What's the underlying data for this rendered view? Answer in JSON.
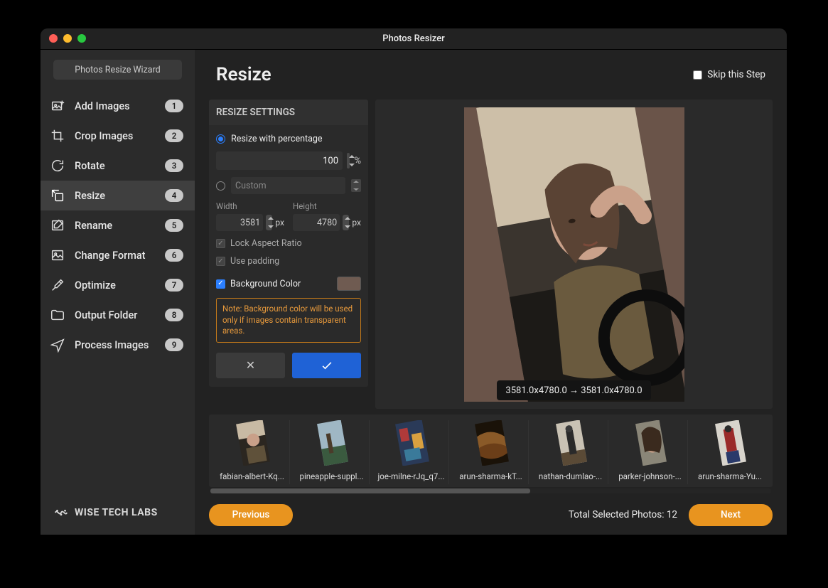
{
  "window": {
    "title": "Photos Resizer"
  },
  "sidebar": {
    "wizard_button": "Photos Resize Wizard",
    "items": [
      {
        "label": "Add Images",
        "badge": "1"
      },
      {
        "label": "Crop Images",
        "badge": "2"
      },
      {
        "label": "Rotate",
        "badge": "3"
      },
      {
        "label": "Resize",
        "badge": "4"
      },
      {
        "label": "Rename",
        "badge": "5"
      },
      {
        "label": "Change Format",
        "badge": "6"
      },
      {
        "label": "Optimize",
        "badge": "7"
      },
      {
        "label": "Output Folder",
        "badge": "8"
      },
      {
        "label": "Process Images",
        "badge": "9"
      }
    ],
    "brand": "WISE TECH LABS"
  },
  "page": {
    "title": "Resize",
    "skip_label": "Skip this Step"
  },
  "settings": {
    "header": "RESIZE SETTINGS",
    "radio_percentage": "Resize with percentage",
    "percentage_value": "100",
    "percent_symbol": "%",
    "radio_custom": "Custom",
    "width_label": "Width",
    "width_value": "3581",
    "height_label": "Height",
    "height_value": "4780",
    "unit": "px",
    "lock_label": "Lock Aspect Ratio",
    "padding_label": "Use padding",
    "bgcolor_label": "Background Color",
    "bgcolor_value": "#6f5b51",
    "note": "Note: Background color will be used only if images contain transparent areas."
  },
  "preview": {
    "dimensions_text": "3581.0x4780.0 → 3581.0x4780.0"
  },
  "thumbnails": [
    {
      "name": "fabian-albert-Kq..."
    },
    {
      "name": "pineapple-suppl..."
    },
    {
      "name": "joe-milne-rJq_q7..."
    },
    {
      "name": "arun-sharma-kT..."
    },
    {
      "name": "nathan-dumlao-..."
    },
    {
      "name": "parker-johnson-..."
    },
    {
      "name": "arun-sharma-Yu..."
    }
  ],
  "footer": {
    "previous": "Previous",
    "next": "Next",
    "total_label": "Total Selected Photos: 12"
  }
}
